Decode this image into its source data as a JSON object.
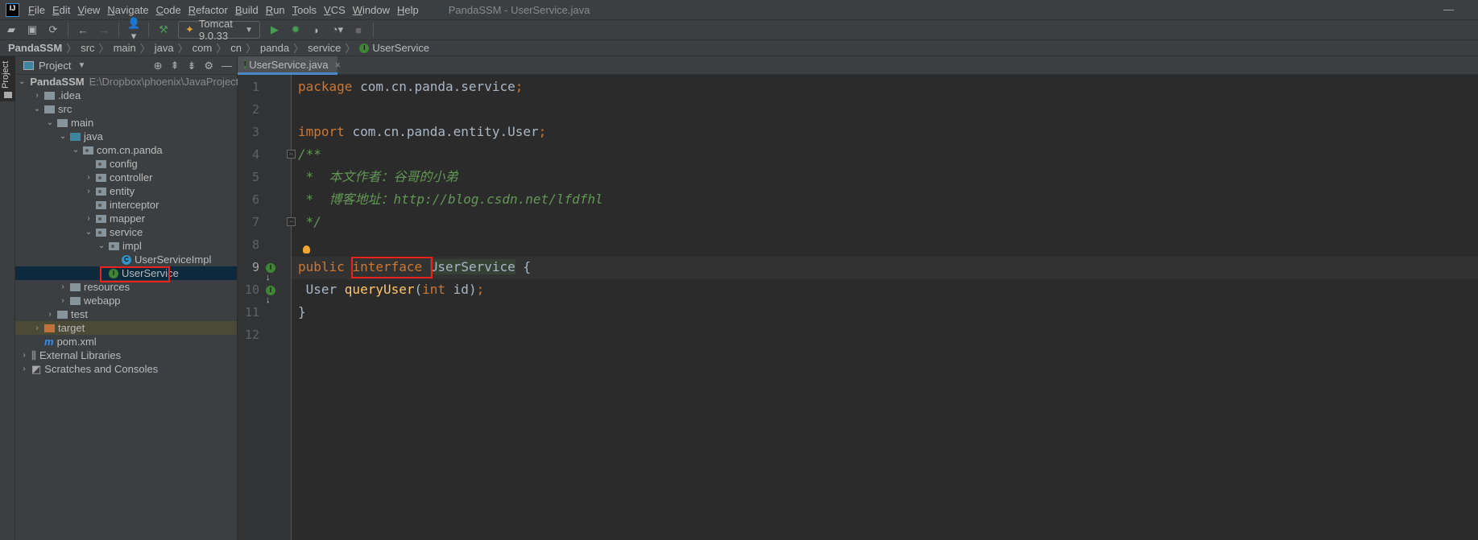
{
  "menubar": {
    "logo": "IJ",
    "items": [
      "File",
      "Edit",
      "View",
      "Navigate",
      "Code",
      "Refactor",
      "Build",
      "Run",
      "Tools",
      "VCS",
      "Window",
      "Help"
    ],
    "title": "PandaSSM - UserService.java"
  },
  "toolbar": {
    "run_config": "Tomcat 9.0.33"
  },
  "breadcrumb": [
    "PandaSSM",
    "src",
    "main",
    "java",
    "com",
    "cn",
    "panda",
    "service",
    "UserService"
  ],
  "sidebar": {
    "stripe_label": "Project",
    "panel_title": "Project"
  },
  "tree": [
    {
      "label": "PandaSSM",
      "path": "E:\\Dropbox\\phoenix\\JavaProjects\\Pa",
      "level": 0,
      "arrow": "open",
      "icon": "module"
    },
    {
      "label": ".idea",
      "level": 1,
      "arrow": "closed",
      "icon": "folder"
    },
    {
      "label": "src",
      "level": 1,
      "arrow": "open",
      "icon": "folder"
    },
    {
      "label": "main",
      "level": 2,
      "arrow": "open",
      "icon": "folder"
    },
    {
      "label": "java",
      "level": 3,
      "arrow": "open",
      "icon": "source-folder"
    },
    {
      "label": "com.cn.panda",
      "level": 4,
      "arrow": "open",
      "icon": "package"
    },
    {
      "label": "config",
      "level": 5,
      "arrow": "none",
      "icon": "package"
    },
    {
      "label": "controller",
      "level": 5,
      "arrow": "closed",
      "icon": "package"
    },
    {
      "label": "entity",
      "level": 5,
      "arrow": "closed",
      "icon": "package"
    },
    {
      "label": "interceptor",
      "level": 5,
      "arrow": "none",
      "icon": "package"
    },
    {
      "label": "mapper",
      "level": 5,
      "arrow": "closed",
      "icon": "package"
    },
    {
      "label": "service",
      "level": 5,
      "arrow": "open",
      "icon": "package"
    },
    {
      "label": "impl",
      "level": 6,
      "arrow": "open",
      "icon": "package"
    },
    {
      "label": "UserServiceImpl",
      "level": 7,
      "arrow": "none",
      "icon": "class"
    },
    {
      "label": "UserService",
      "level": 6,
      "arrow": "none",
      "icon": "interface",
      "selected": true
    },
    {
      "label": "resources",
      "level": 3,
      "arrow": "closed",
      "icon": "resources-folder"
    },
    {
      "label": "webapp",
      "level": 3,
      "arrow": "closed",
      "icon": "web-folder"
    },
    {
      "label": "test",
      "level": 2,
      "arrow": "closed",
      "icon": "folder"
    },
    {
      "label": "target",
      "level": 1,
      "arrow": "closed",
      "icon": "excluded-folder"
    },
    {
      "label": "pom.xml",
      "level": 1,
      "arrow": "none",
      "icon": "maven"
    },
    {
      "label": "External Libraries",
      "level": 0,
      "arrow": "closed",
      "icon": "libraries"
    },
    {
      "label": "Scratches and Consoles",
      "level": 0,
      "arrow": "closed",
      "icon": "scratches"
    }
  ],
  "editor": {
    "tab": "UserService.java",
    "current_line": 9,
    "lines": [
      [
        [
          "kw",
          "package "
        ],
        [
          "",
          "com.cn.panda.service"
        ],
        [
          "kw",
          ";"
        ]
      ],
      [],
      [
        [
          "kw",
          "import "
        ],
        [
          "",
          "com.cn.panda.entity.User"
        ],
        [
          "kw",
          ";"
        ]
      ],
      [
        [
          "cm",
          "/**"
        ]
      ],
      [
        [
          "cm",
          " *  本文作者：谷哥的小弟"
        ]
      ],
      [
        [
          "cm",
          " *  博客地址：http://blog.csdn.net/lfdfhl"
        ]
      ],
      [
        [
          "cm",
          " */"
        ]
      ],
      [],
      [
        [
          "kw",
          "public "
        ],
        [
          "kw",
          "interface"
        ],
        [
          "",
          " "
        ],
        [
          "hl",
          "UserService"
        ],
        [
          "",
          " {"
        ]
      ],
      [
        [
          "",
          " User "
        ],
        [
          "fn",
          "queryUser"
        ],
        [
          "",
          "("
        ],
        [
          "kw",
          "int "
        ],
        [
          "",
          "id)"
        ],
        [
          "kw",
          ";"
        ]
      ],
      [
        [
          "",
          "}"
        ]
      ],
      []
    ]
  },
  "colors": {
    "keyword": "#cc7832",
    "comment": "#629755",
    "method": "#ffc66d",
    "highlight_box": "#e8231d"
  }
}
